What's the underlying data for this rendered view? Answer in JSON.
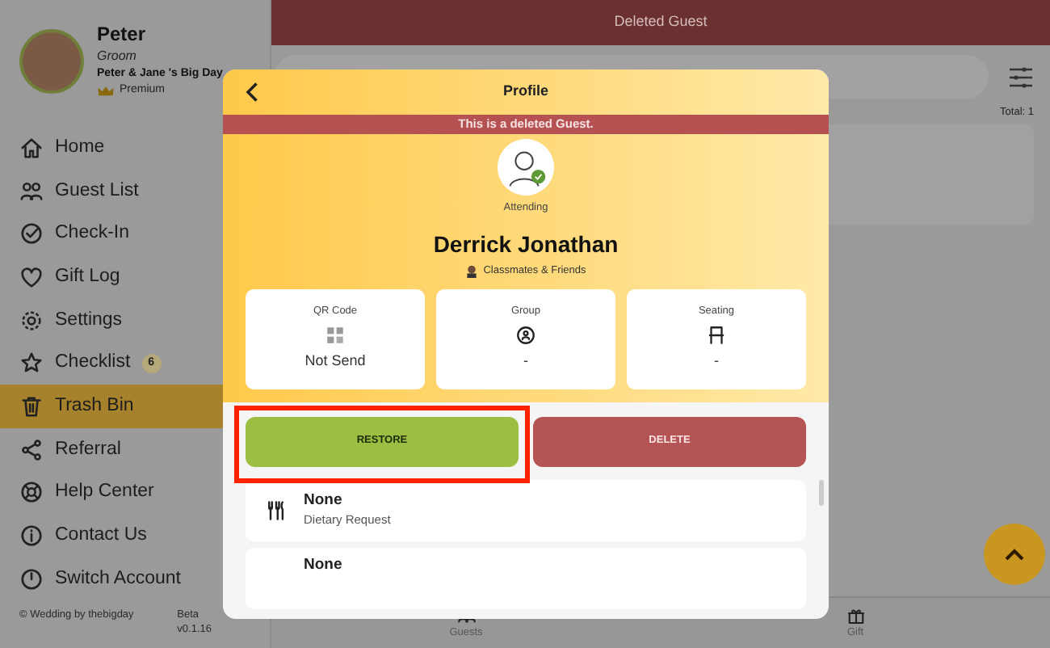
{
  "profile": {
    "name": "Peter",
    "role": "Groom",
    "event": "Peter & Jane 's Big Day",
    "plan": "Premium"
  },
  "sidebar": {
    "items": [
      {
        "label": "Home",
        "selected": false
      },
      {
        "label": "Guest List",
        "selected": false
      },
      {
        "label": "Check-In",
        "selected": false
      },
      {
        "label": "Gift Log",
        "selected": false
      },
      {
        "label": "Settings",
        "selected": false
      },
      {
        "label": "Checklist",
        "selected": false,
        "badge": "6"
      },
      {
        "label": "Trash Bin",
        "selected": true
      },
      {
        "label": "Referral",
        "selected": false
      },
      {
        "label": "Help Center",
        "selected": false
      },
      {
        "label": "Contact Us",
        "selected": false
      },
      {
        "label": "Switch Account",
        "selected": false
      }
    ]
  },
  "footer": {
    "copyright": "© Wedding by thebigday",
    "version_label": "Beta",
    "version": "v0.1.16"
  },
  "header": {
    "title": "Deleted Guest"
  },
  "total": "Total: 1",
  "bottom_nav": [
    {
      "label": "Guests"
    },
    {
      "label": "Gift"
    }
  ],
  "modal": {
    "title": "Profile",
    "notice": "This is a deleted Guest.",
    "status": "Attending",
    "guest_name": "Derrick Jonathan",
    "group_name": "Classmates & Friends",
    "info_cards": [
      {
        "label": "QR Code",
        "value": "Not Send"
      },
      {
        "label": "Group",
        "value": "-"
      },
      {
        "label": "Seating",
        "value": "-"
      }
    ],
    "actions": [
      {
        "label": "RESTORE",
        "kind": "restore",
        "highlighted": true
      },
      {
        "label": "DELETE",
        "kind": "delete",
        "highlighted": false
      }
    ],
    "details": [
      {
        "value": "None",
        "label": "Dietary Request"
      },
      {
        "value": "None"
      }
    ]
  }
}
